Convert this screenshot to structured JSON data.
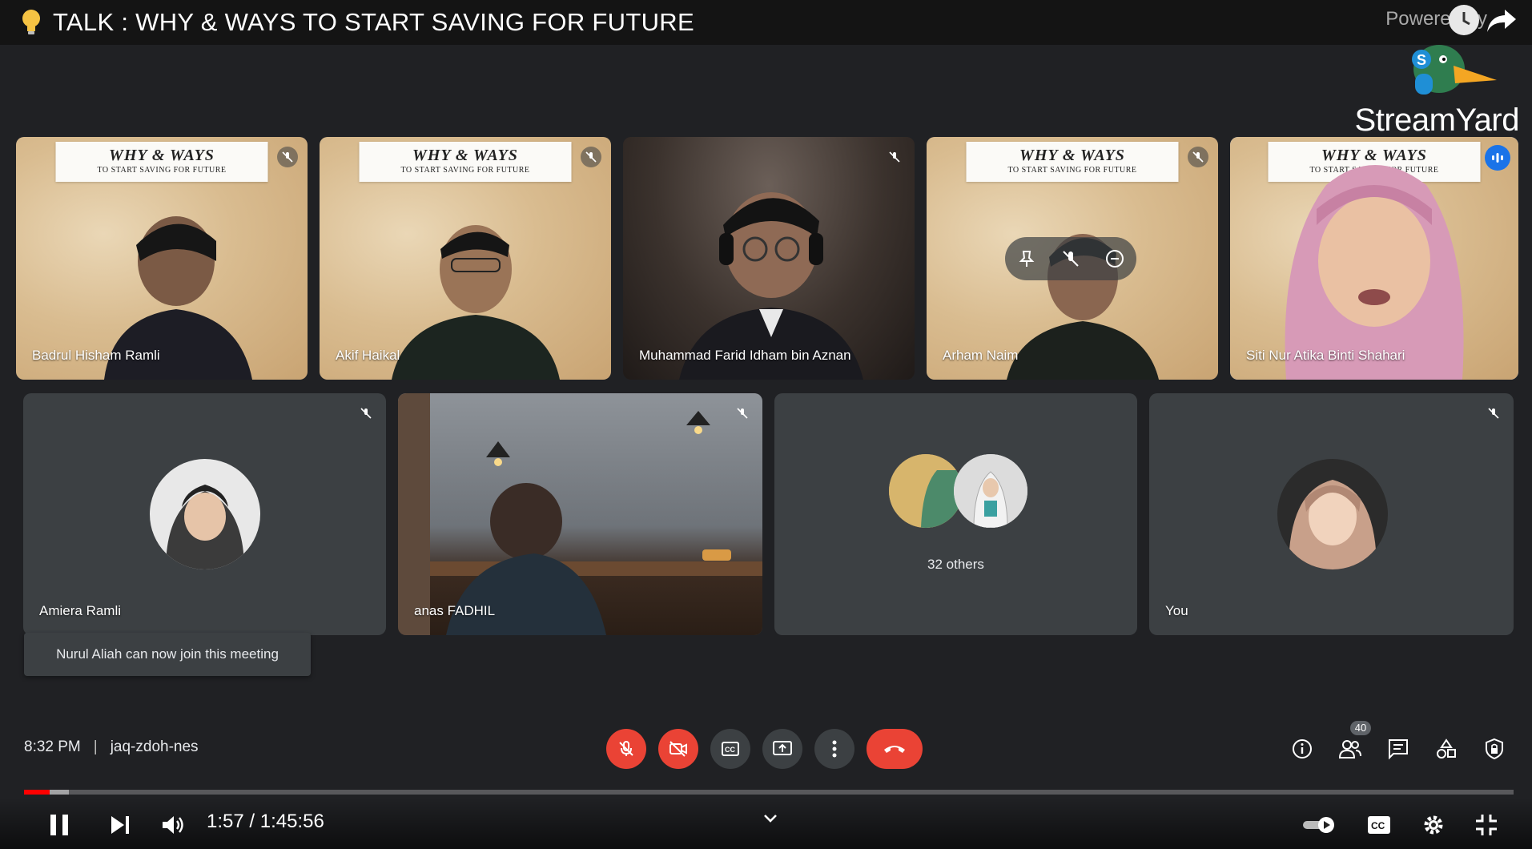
{
  "header": {
    "title": "TALK : WHY & WAYS TO START SAVING FOR FUTURE",
    "powered_by": "Powered by",
    "brand": "StreamYard"
  },
  "banner": {
    "line1": "WHY & WAYS",
    "line2": "TO START SAVING FOR FUTURE"
  },
  "participants_top": [
    {
      "name": "Badrul Hisham Ramli"
    },
    {
      "name": "Akif Haikal"
    },
    {
      "name": "Muhammad Farid Idham bin Aznan"
    },
    {
      "name": "Arham Naim"
    },
    {
      "name": "Siti Nur Atika Binti Shahari"
    }
  ],
  "participants_bottom": [
    {
      "name": "Amiera Ramli"
    },
    {
      "name": "anas FADHIL"
    },
    {
      "name": "32 others"
    },
    {
      "name": "You"
    }
  ],
  "toast": "Nurul Aliah can now join this meeting",
  "meeting": {
    "time": "8:32 PM",
    "code": "jaq-zdoh-nes",
    "participant_count": "40"
  },
  "player": {
    "time_display": "1:57 / 1:45:56",
    "progress_played": 0.017,
    "progress_loaded": 0.03
  },
  "colors": {
    "red": "#ea4335",
    "active_outline": "#8ab4f8",
    "progress": "#ff0000"
  }
}
